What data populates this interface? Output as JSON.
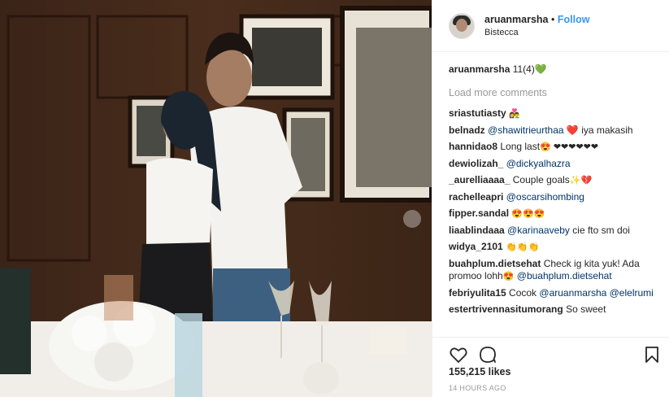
{
  "header": {
    "username": "aruanmarsha",
    "separator": "•",
    "follow_label": "Follow",
    "location": "Bistecca"
  },
  "caption": {
    "username": "aruanmarsha",
    "text": "11(4)",
    "emoji": "💚"
  },
  "load_more_label": "Load more comments",
  "comments": [
    {
      "user": "sriastutiasty",
      "text": "",
      "mention": "",
      "emoji": "👩‍❤️‍👨"
    },
    {
      "user": "belnadz",
      "mention": "@shawitrieurthaa",
      "text": " iya makasih",
      "emoji": "❤️"
    },
    {
      "user": "hannidao8",
      "text": "Long last",
      "mention": "",
      "emoji": "😍 ❤❤❤❤❤❤"
    },
    {
      "user": "dewiolizah_",
      "mention": "@dickyalhazra",
      "text": "",
      "emoji": ""
    },
    {
      "user": "_aurelliaaaa_",
      "text": "Couple goals",
      "mention": "",
      "emoji": "✨💔"
    },
    {
      "user": "rachelleapri",
      "mention": "@oscarsihombing",
      "text": "",
      "emoji": ""
    },
    {
      "user": "fipper.sandal",
      "text": "",
      "mention": "",
      "emoji": "😍😍😍"
    },
    {
      "user": "liaablindaaa",
      "mention": "@karinaaveby",
      "text": " cie fto sm doi",
      "emoji": ""
    },
    {
      "user": "widya_2101",
      "text": "",
      "mention": "",
      "emoji": "👏👏👏"
    },
    {
      "user": "buahplum.dietsehat",
      "text": "Check ig kita yuk! Ada promoo lohh",
      "mention": "@buahplum.dietsehat",
      "emoji": "😍"
    },
    {
      "user": "febriyulita15",
      "text": "Cocok",
      "mention": "@aruanmarsha @elelrumi",
      "emoji": ""
    },
    {
      "user": "estertrivennasitumorang",
      "text": "So sweet",
      "mention": "",
      "emoji": ""
    }
  ],
  "likes": "155,215 likes",
  "timestamp": "14 HOURS AGO",
  "icons": {
    "like": "heart-outline-icon",
    "comment": "comment-bubble-icon",
    "save": "bookmark-icon"
  }
}
